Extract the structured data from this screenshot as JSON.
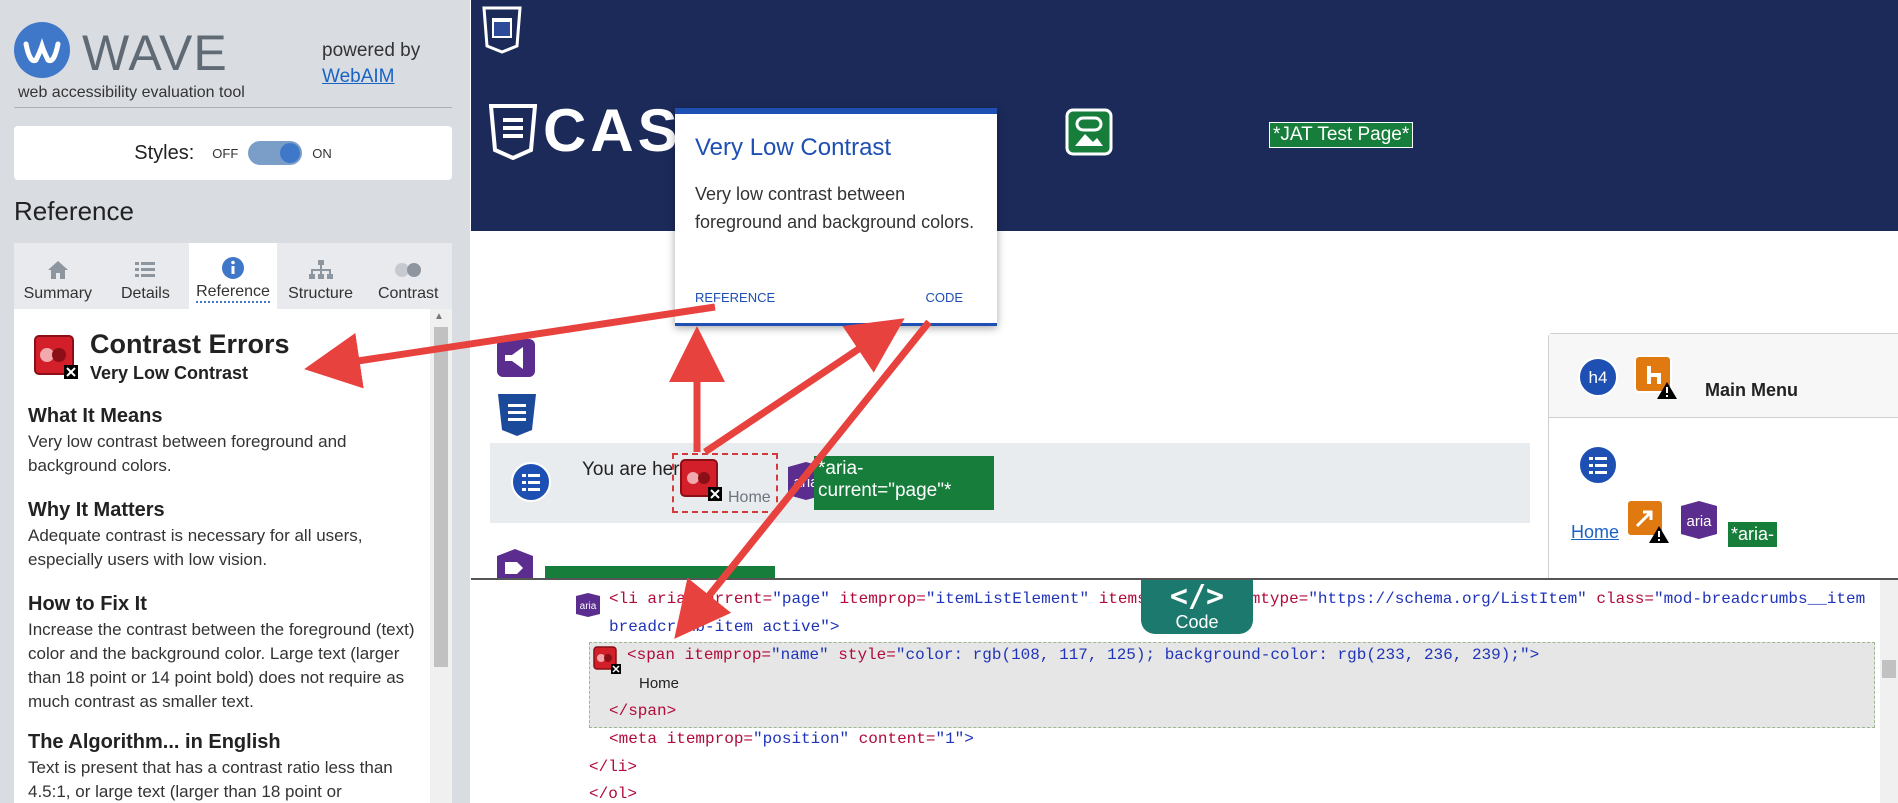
{
  "wave": {
    "logo_text": "WAVE",
    "tagline": "web accessibility evaluation tool",
    "powered_by": "powered by",
    "webaim_link": "WebAIM",
    "styles_label": "Styles:",
    "toggle_off": "OFF",
    "toggle_on": "ON",
    "toggle_state": "on",
    "reference_heading": "Reference",
    "tabs": [
      {
        "label": "Summary",
        "icon": "home-icon"
      },
      {
        "label": "Details",
        "icon": "list-icon"
      },
      {
        "label": "Reference",
        "icon": "info-icon",
        "active": true
      },
      {
        "label": "Structure",
        "icon": "structure-icon"
      },
      {
        "label": "Contrast",
        "icon": "contrast-icon"
      }
    ],
    "ref": {
      "title": "Contrast Errors",
      "subtitle": "Very Low Contrast",
      "sections": [
        {
          "heading": "What It Means",
          "body": "Very low contrast between foreground and background colors."
        },
        {
          "heading": "Why It Matters",
          "body": "Adequate contrast is necessary for all users, especially users with low vision."
        },
        {
          "heading": "How to Fix It",
          "body": "Increase the contrast between the foreground (text) color and the background color. Large text (larger than 18 point or 14 point bold) does not require as much contrast as smaller text."
        },
        {
          "heading": "The Algorithm... in English",
          "body": "Text is present that has a contrast ratio less than 4.5:1, or large text (larger than 18 point or"
        }
      ]
    }
  },
  "preview": {
    "site_text": "CASS",
    "jat_label": "*JAT Test Page*",
    "you_are_here": "You are here:",
    "home": "Home",
    "aria_current": "*aria-current=\"page\"*",
    "aria_badge": "aria",
    "h4_badge": "h4",
    "main_menu": "Main Menu",
    "menu_home": "Home",
    "aria_partial": "*aria-"
  },
  "tooltip": {
    "title": "Very Low Contrast",
    "body": "Very low contrast between foreground and background colors.",
    "reference_link": "REFERENCE",
    "code_link": "CODE"
  },
  "code": {
    "tab_icon": "</>",
    "tab_label": "Code",
    "line1_a": "<li ",
    "line1_b": "aria-current=",
    "line1_c": "\"page\" ",
    "line1_d": "itemprop=",
    "line1_e": "\"itemListElement\" ",
    "line1_f": "items",
    "line1_g": "mtype=",
    "line1_h": "\"https://schema.org/ListItem\" ",
    "line1_i": "class=",
    "line1_j": "\"mod-breadcrumbs__item",
    "line2": "breadcrumb-item active\">",
    "line3_a": "<span ",
    "line3_b": "itemprop=",
    "line3_c": "\"name\" ",
    "line3_d": "style=",
    "line3_e": "\"color: rgb(108, 117, 125); background-color: rgb(233, 236, 239);\">",
    "line4": "Home",
    "line5": "</span>",
    "line6_a": "<meta ",
    "line6_b": "itemprop=",
    "line6_c": "\"position\" ",
    "line6_d": "content=",
    "line6_e": "\"1\">",
    "line7": "</li>",
    "line8": "</ol>"
  },
  "colors": {
    "header_navy": "#1c2a5a",
    "wave_blue": "#3f78c9",
    "label_green": "#167d3b",
    "arrow_red": "#e8423f",
    "tooltip_blue": "#1e4fb3",
    "code_tab_teal": "#1b7a6d"
  }
}
